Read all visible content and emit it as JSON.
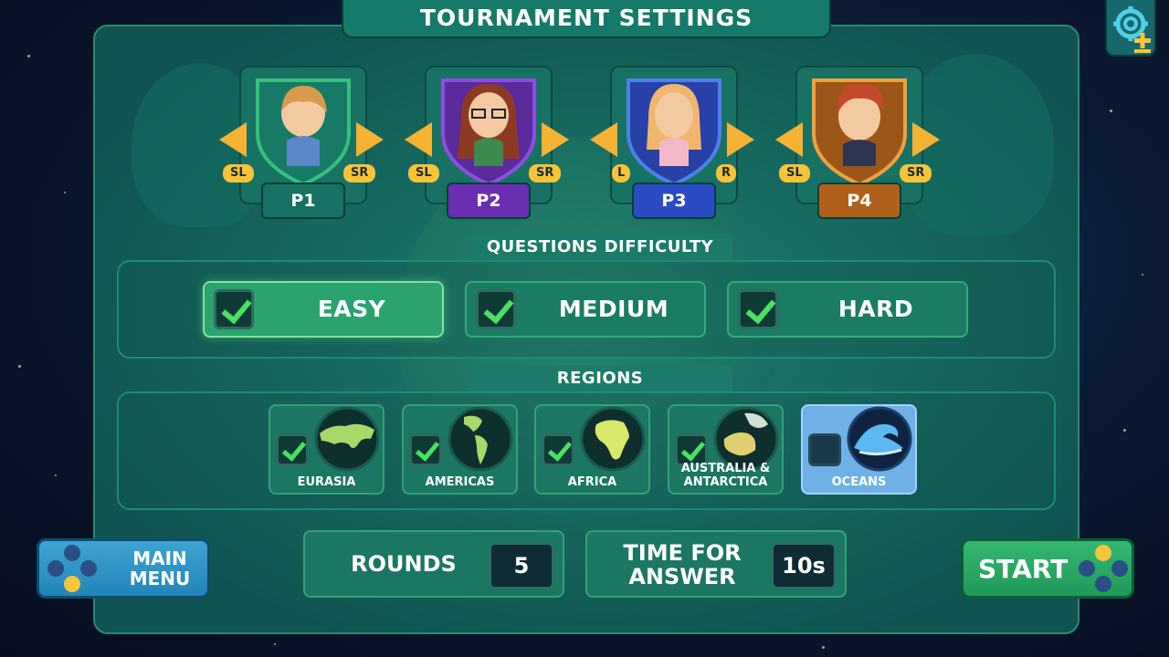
{
  "screen_title": "TOURNAMENT SETTINGS",
  "settings_icon": "gear-plus-icon",
  "players": [
    {
      "label": "P1",
      "left_button": "SL",
      "right_button": "SR",
      "color": "#177a66",
      "label_color": "#177264"
    },
    {
      "label": "P2",
      "left_button": "SL",
      "right_button": "SR",
      "color": "#5b2b9c",
      "label_color": "#6a2fb3"
    },
    {
      "label": "P3",
      "left_button": "L",
      "right_button": "R",
      "color": "#2741a8",
      "label_color": "#2b4bc4"
    },
    {
      "label": "P4",
      "left_button": "SL",
      "right_button": "SR",
      "color": "#9c5718",
      "label_color": "#b0601a"
    }
  ],
  "difficulty": {
    "heading": "QUESTIONS DIFFICULTY",
    "options": [
      {
        "label": "EASY",
        "checked": true,
        "active": true
      },
      {
        "label": "MEDIUM",
        "checked": true,
        "active": false
      },
      {
        "label": "HARD",
        "checked": true,
        "active": false
      }
    ]
  },
  "regions": {
    "heading": "REGIONS",
    "items": [
      {
        "label": "EURASIA",
        "checked": true,
        "icon": "eurasia-map-icon"
      },
      {
        "label": "AMERICAS",
        "checked": true,
        "icon": "americas-map-icon"
      },
      {
        "label": "AFRICA",
        "checked": true,
        "icon": "africa-map-icon"
      },
      {
        "label": "AUSTRALIA & ANTARCTICA",
        "checked": true,
        "icon": "australia-map-icon"
      },
      {
        "label": "OCEANS",
        "checked": false,
        "icon": "ocean-wave-icon"
      }
    ]
  },
  "rounds": {
    "label": "ROUNDS",
    "value": "5"
  },
  "time_for_answer": {
    "label": "TIME FOR ANSWER",
    "value": "10s"
  },
  "main_menu_button": {
    "label": "MAIN MENU"
  },
  "start_button": {
    "label": "START"
  }
}
